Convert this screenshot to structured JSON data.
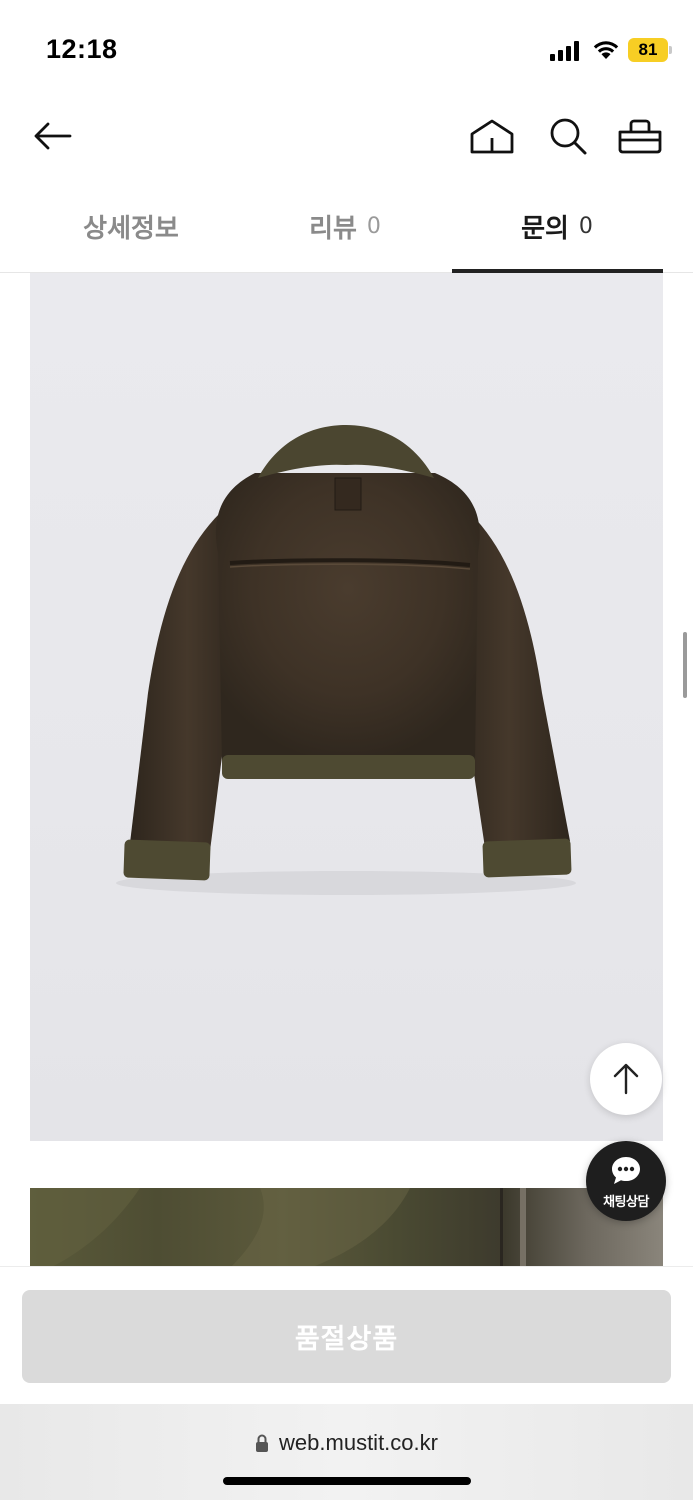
{
  "status_bar": {
    "time": "12:18",
    "battery_level": "81",
    "icons": [
      "cellular-signal-icon",
      "wifi-icon",
      "battery-icon"
    ],
    "battery_color": "#f7ce24"
  },
  "header": {
    "icons": [
      "back-arrow-icon",
      "home-icon",
      "search-icon",
      "shopping-basket-icon"
    ]
  },
  "tabs": [
    {
      "label": "상세정보",
      "count": "",
      "active": false
    },
    {
      "label": "리뷰",
      "count": "0",
      "active": false
    },
    {
      "label": "문의",
      "count": "0",
      "active": true
    }
  ],
  "content": {
    "product_image": "brown shearling aviator jacket back view",
    "detail_image": "jacket fleece collar close-up"
  },
  "floating": {
    "top_icon": "arrow-up-icon",
    "chat_label": "채팅상담",
    "chat_icon": "chat-bubble-icon"
  },
  "bottom_action": {
    "button_label": "품절상품",
    "button_color": "#dadada"
  },
  "browser": {
    "url": "web.mustit.co.kr",
    "lock_icon": "lock-icon"
  }
}
